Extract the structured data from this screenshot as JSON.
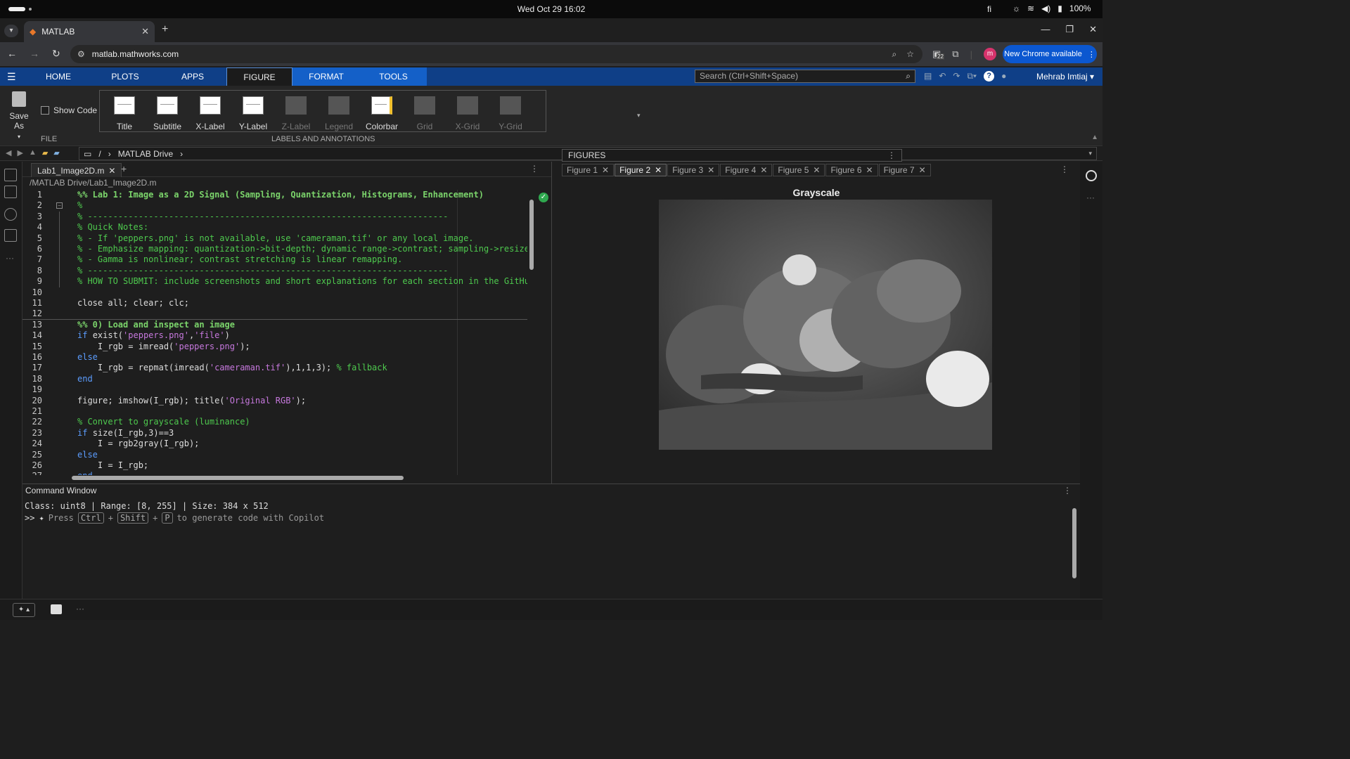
{
  "os": {
    "clock": "Wed Oct 29  16:02",
    "lang": "fi",
    "battery": "100%"
  },
  "browser": {
    "tab_title": "MATLAB",
    "url": "matlab.mathworks.com",
    "ext_badge": "22",
    "avatar_letter": "m",
    "new_chrome": "New Chrome available"
  },
  "toolstrip": {
    "tabs": [
      "HOME",
      "PLOTS",
      "APPS",
      "FIGURE",
      "FORMAT",
      "TOOLS"
    ],
    "active_tab": "FIGURE",
    "search_placeholder": "Search (Ctrl+Shift+Space)",
    "user": "Mehrab Imtiaj"
  },
  "ribbon": {
    "save_as": "Save As",
    "show_code": "Show Code",
    "file_section": "FILE",
    "labels_section": "LABELS AND ANNOTATIONS",
    "buttons": [
      {
        "label": "Title",
        "enabled": true
      },
      {
        "label": "Subtitle",
        "enabled": true
      },
      {
        "label": "X-Label",
        "enabled": true
      },
      {
        "label": "Y-Label",
        "enabled": true
      },
      {
        "label": "Z-Label",
        "enabled": false
      },
      {
        "label": "Legend",
        "enabled": false
      },
      {
        "label": "Colorbar",
        "enabled": true
      },
      {
        "label": "Grid",
        "enabled": false
      },
      {
        "label": "X-Grid",
        "enabled": false
      },
      {
        "label": "Y-Grid",
        "enabled": false
      }
    ]
  },
  "pathbar": {
    "root": "/",
    "folder": "MATLAB Drive"
  },
  "editor": {
    "file_tab": "Lab1_Image2D.m",
    "file_path": "/MATLAB Drive/Lab1_Image2D.m",
    "lines": [
      {
        "n": "1",
        "t": "%% Lab 1: Image as a 2D Signal (Sampling, Quantization, Histograms, Enhancement)",
        "k": "sec"
      },
      {
        "n": "2",
        "t": "%",
        "k": "com"
      },
      {
        "n": "3",
        "t": "% -----------------------------------------------------------------------",
        "k": "com"
      },
      {
        "n": "4",
        "t": "% Quick Notes:",
        "k": "com"
      },
      {
        "n": "5",
        "t": "% - If 'peppers.png' is not available, use 'cameraman.tif' or any local image.",
        "k": "com"
      },
      {
        "n": "6",
        "t": "% - Emphasize mapping: quantization->bit-depth; dynamic range->contrast; sampling->resize",
        "k": "com"
      },
      {
        "n": "7",
        "t": "% - Gamma is nonlinear; contrast stretching is linear remapping.",
        "k": "com"
      },
      {
        "n": "8",
        "t": "% -----------------------------------------------------------------------",
        "k": "com"
      },
      {
        "n": "9",
        "t": "% HOW TO SUBMIT: include screenshots and short explanations for each section in the GitHu",
        "k": "com"
      },
      {
        "n": "10",
        "t": "",
        "k": "def"
      },
      {
        "n": "11",
        "t": "close all; clear; clc;",
        "k": "def"
      },
      {
        "n": "12",
        "t": "",
        "k": "def"
      },
      {
        "n": "13",
        "t": "%% 0) Load and inspect an image",
        "k": "sec"
      },
      {
        "n": "14",
        "t": "",
        "k": "mix",
        "parts": [
          [
            "if ",
            "kw"
          ],
          [
            "exist(",
            "def"
          ],
          [
            "'peppers.png'",
            "str"
          ],
          [
            ",",
            "def"
          ],
          [
            "'file'",
            "str"
          ],
          [
            ")",
            "def"
          ]
        ]
      },
      {
        "n": "15",
        "t": "",
        "k": "mix",
        "parts": [
          [
            "    I_rgb = imread(",
            "def"
          ],
          [
            "'peppers.png'",
            "str"
          ],
          [
            ");",
            "def"
          ]
        ]
      },
      {
        "n": "16",
        "t": "else",
        "k": "kw"
      },
      {
        "n": "17",
        "t": "",
        "k": "mix",
        "parts": [
          [
            "    I_rgb = repmat(imread(",
            "def"
          ],
          [
            "'cameraman.tif'",
            "str"
          ],
          [
            "),1,1,3); ",
            "def"
          ],
          [
            "% fallback",
            "com"
          ]
        ]
      },
      {
        "n": "18",
        "t": "end",
        "k": "kw"
      },
      {
        "n": "19",
        "t": "",
        "k": "def"
      },
      {
        "n": "20",
        "t": "",
        "k": "mix",
        "parts": [
          [
            "figure; imshow(I_rgb); title(",
            "def"
          ],
          [
            "'Original RGB'",
            "str"
          ],
          [
            ");",
            "def"
          ]
        ]
      },
      {
        "n": "21",
        "t": "",
        "k": "def"
      },
      {
        "n": "22",
        "t": "% Convert to grayscale (luminance)",
        "k": "com"
      },
      {
        "n": "23",
        "t": "",
        "k": "mix",
        "parts": [
          [
            "if ",
            "kw"
          ],
          [
            "size(I_rgb,3)==3",
            "def"
          ]
        ]
      },
      {
        "n": "24",
        "t": "    I = rgb2gray(I_rgb);",
        "k": "def"
      },
      {
        "n": "25",
        "t": "else",
        "k": "kw"
      },
      {
        "n": "26",
        "t": "    I = I_rgb;",
        "k": "def"
      },
      {
        "n": "27",
        "t": "end",
        "k": "kw"
      }
    ]
  },
  "figures": {
    "header": "FIGURES",
    "tabs": [
      "Figure 1",
      "Figure 2",
      "Figure 3",
      "Figure 4",
      "Figure 5",
      "Figure 6",
      "Figure 7"
    ],
    "active": "Figure 2",
    "plot_title": "Grayscale"
  },
  "command_window": {
    "title": "Command Window",
    "output": "Class: uint8 | Range: [8, 255] | Size: 384 x 512",
    "prompt": ">>",
    "hint_pre": "Press",
    "key1": "Ctrl",
    "plus": "+",
    "key2": "Shift",
    "key3": "P",
    "hint_post": "to generate code with Copilot"
  }
}
